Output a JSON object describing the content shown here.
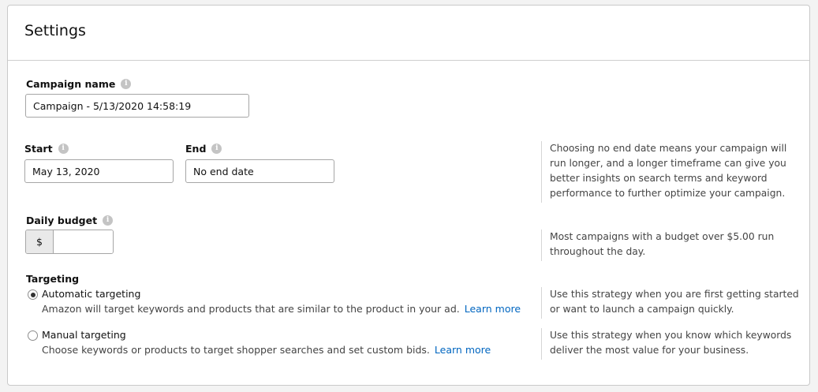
{
  "settings": {
    "title": "Settings",
    "campaign_name": {
      "label": "Campaign name",
      "value": "Campaign - 5/13/2020 14:58:19"
    },
    "start": {
      "label": "Start",
      "value": "May 13, 2020"
    },
    "end": {
      "label": "End",
      "value": "No end date"
    },
    "end_help": "Choosing no end date means your campaign will run longer, and a longer timeframe can give you better insights on search terms and keyword performance to further optimize your campaign.",
    "daily_budget": {
      "label": "Daily budget",
      "currency": "$",
      "value": "",
      "help": "Most campaigns with a budget over $5.00 run throughout the day."
    },
    "targeting": {
      "title": "Targeting",
      "automatic": {
        "label": "Automatic targeting",
        "description": "Amazon will target keywords and products that are similar to the product in your ad.",
        "link": "Learn more",
        "help": "Use this strategy when you are first getting started or want to launch a campaign quickly.",
        "selected": true
      },
      "manual": {
        "label": "Manual targeting",
        "description": "Choose keywords or products to target shopper searches and set custom bids.",
        "link": "Learn more",
        "help": "Use this strategy when you know which keywords deliver the most value for your business.",
        "selected": false
      }
    }
  },
  "icons": {
    "info": "info-icon",
    "radio": "radio-icon"
  },
  "colors": {
    "link": "#0066c0",
    "border": "#a6a6a6",
    "panel_border": "#c9c9c9"
  }
}
